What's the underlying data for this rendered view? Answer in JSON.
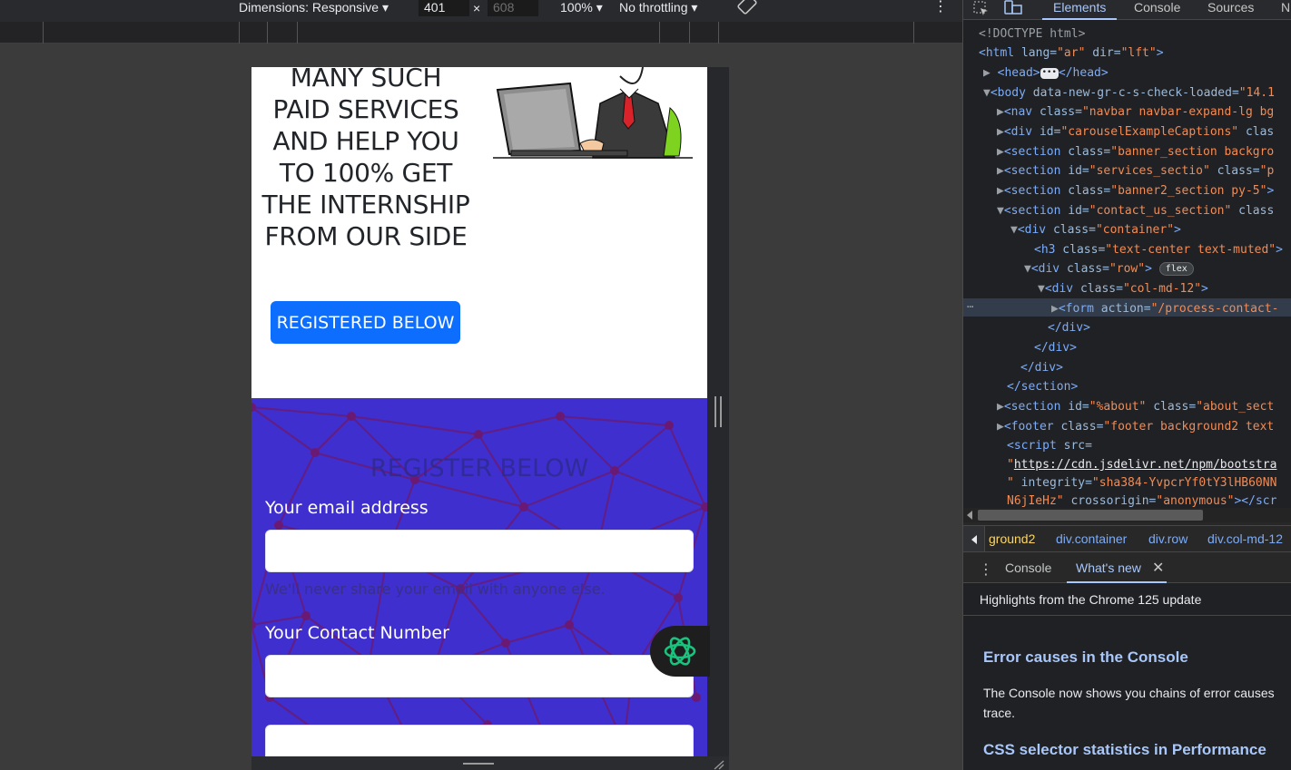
{
  "device_toolbar": {
    "dimensions_label": "Dimensions: Responsive ▾",
    "width": "401",
    "times": "×",
    "height": "608",
    "zoom": "100% ▾",
    "throttling": "No throttling ▾",
    "more": "⋮"
  },
  "page": {
    "banner_heading": "MANY SUCH PAID SERVICES AND HELP YOU TO 100% GET THE INTERNSHIP FROM OUR SIDE",
    "register_button": "REGISTERED BELOW",
    "contact_title": "REGISTER BELOW",
    "email_label": "Your email address",
    "email_helper": "We'll never share your email with anyone else.",
    "contact_label": "Your Contact Number",
    "colors": {
      "primary": "#0d6efd",
      "contact_bg": "#3e2fce",
      "net_line": "#6b1a74"
    }
  },
  "devtools": {
    "tabs": [
      "Elements",
      "Console",
      "Sources",
      "N"
    ],
    "dom_lines": {
      "l1": "<!DOCTYPE html>",
      "l2_tag": "<html",
      "l2_attr1": " lang=",
      "l2_val1": "\"ar\"",
      "l2_attr2": " dir=",
      "l2_val2": "\"lft\"",
      "l2_end": ">",
      "l3": "<head>",
      "l3_end": "</head>",
      "l4": "<body",
      "l4_attr": " data-new-gr-c-s-check-loaded=",
      "l4_val": "\"14.1",
      "l5_tag": "<nav",
      "l5_attr": " class=",
      "l5_val": "\"navbar navbar-expand-lg bg",
      "l6_tag": "<div",
      "l6_attr": " id=",
      "l6_val": "\"carouselExampleCaptions\"",
      "l6_attr2": " clas",
      "l7_tag": "<section",
      "l7_attr": " class=",
      "l7_val": "\"banner_section backgro",
      "l8_tag": "<section",
      "l8_attr": " id=",
      "l8_val": "\"services_sectio\"",
      "l8_attr2": " class=",
      "l8_val2": "\"p",
      "l9_tag": "<section",
      "l9_attr": " class=",
      "l9_val": "\"banner2_section py-5\"",
      "l9_end": ">",
      "l10_tag": "<section",
      "l10_attr": " id=",
      "l10_val": "\"contact_us_section\"",
      "l10_attr2": " class",
      "l11_tag": "<div",
      "l11_attr": " class=",
      "l11_val": "\"container\"",
      "l11_end": ">",
      "l12_tag": "<h3",
      "l12_attr": " class=",
      "l12_val": "\"text-center text-muted\"",
      "l12_end": ">",
      "l13_tag": "<div",
      "l13_attr": " class=",
      "l13_val": "\"row\"",
      "l13_end": ">",
      "l13_badge": "flex",
      "l14_tag": "<div",
      "l14_attr": " class=",
      "l14_val": "\"col-md-12\"",
      "l14_end": ">",
      "l15_tag": "<form",
      "l15_attr": " action=",
      "l15_val": "\"/process-contact-",
      "l16": "</div>",
      "l17": "</div>",
      "l18": "</div>",
      "l19": "</section>",
      "l20_tag": "<section",
      "l20_attr": " id=",
      "l20_val": "\"%about\"",
      "l20_attr2": " class=",
      "l20_val2": "\"about_sect",
      "l21_tag": "<footer",
      "l21_attr": " class=",
      "l21_val": "\"footer background2 text",
      "l22_tag": "<script",
      "l22_attr": " src=",
      "l23_q": "\"",
      "l23_url": "https://cdn.jsdelivr.net/npm/bootstra",
      "l24_q": "\"",
      "l24_attr": " integrity=",
      "l24_val": "\"sha384-YvpcrYf0tY3lHB60NN",
      "l25_val": "N6jIeHz\"",
      "l25_attr": " crossorigin=",
      "l25_val2": "\"anonymous\"",
      "l25_end": "></scr",
      "dots": "⋯"
    },
    "breadcrumbs": [
      "ground2",
      "div.container",
      "div.row",
      "div.col-md-12"
    ],
    "drawer_tabs": [
      "Console",
      "What's new"
    ],
    "whats_new": {
      "header": "Highlights from the Chrome 125 update",
      "h1": "Error causes in the Console",
      "p1": "The Console now shows you chains of error causes trace.",
      "h2": "CSS selector statistics in Performance"
    }
  }
}
